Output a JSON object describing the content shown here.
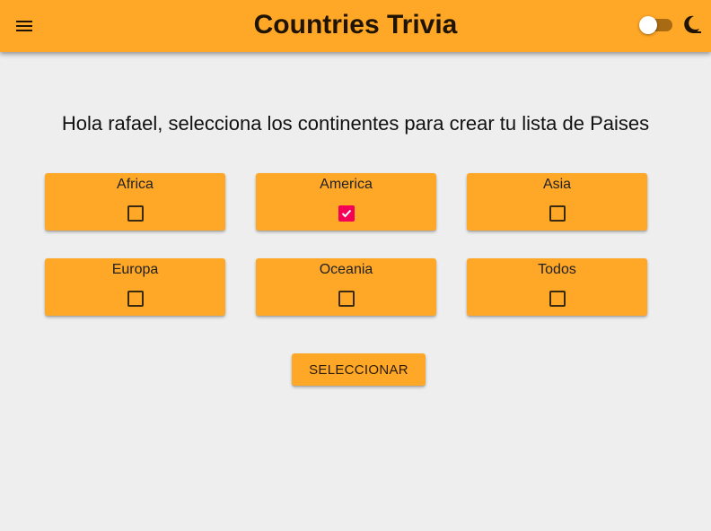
{
  "app": {
    "title": "Countries Trivia",
    "accent_color": "#ffa726",
    "background_color": "#eeeeee",
    "checked_color": "#f50057"
  },
  "header": {
    "menu_icon": "hamburger-menu-icon",
    "theme_toggle": {
      "state": "off"
    },
    "theme_icon": "moon-icon"
  },
  "greeting": "Hola rafael, selecciona los continentes para crear tu lista de Paises",
  "continents": [
    {
      "label": "Africa",
      "checked": false
    },
    {
      "label": "America",
      "checked": true
    },
    {
      "label": "Asia",
      "checked": false
    },
    {
      "label": "Europa",
      "checked": false
    },
    {
      "label": "Oceania",
      "checked": false
    },
    {
      "label": "Todos",
      "checked": false
    }
  ],
  "submit_label": "SELECCIONAR"
}
